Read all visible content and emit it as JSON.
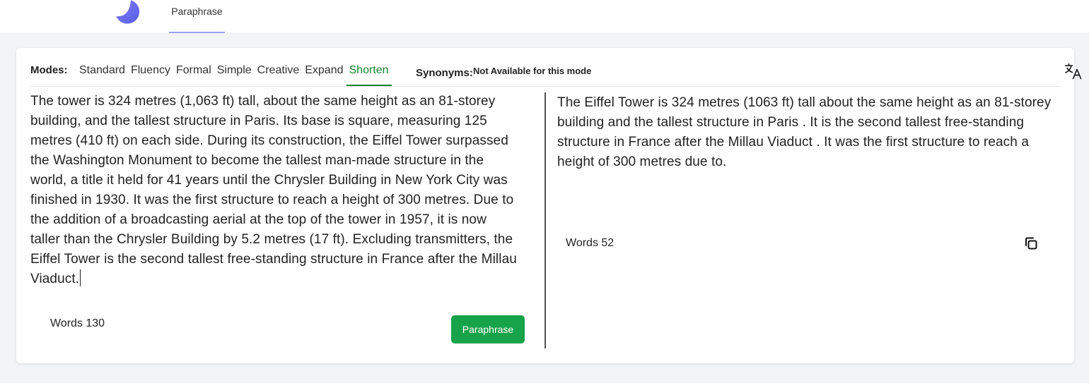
{
  "header": {
    "nav_tab": "Paraphrase",
    "logo_icon": "moon-logo-icon",
    "colors": {
      "logo": "#6366f1",
      "tab_underline": "#9aa0f0"
    }
  },
  "modes": {
    "label": "Modes:",
    "items": [
      "Standard",
      "Fluency",
      "Formal",
      "Simple",
      "Creative",
      "Expand",
      "Shorten"
    ],
    "active": "Shorten",
    "active_color": "#16822d"
  },
  "synonyms": {
    "label": "Synonyms:",
    "value": "Not Available for this mode"
  },
  "toolbar": {
    "translate_icon": "translate-icon"
  },
  "input": {
    "text": "The tower is 324 metres (1,063 ft) tall, about the same height as an 81-storey building, and the tallest structure in Paris. Its base is square, measuring 125 metres (410 ft) on each side. During its construction, the Eiffel Tower surpassed the Washington Monument to become the tallest man-made structure in the world, a title it held for 41 years until the Chrysler Building in New York City was finished in 1930. It was the first structure to reach a height of 300 metres. Due to the addition of a broadcasting aerial at the top of the tower in 1957, it is now taller than the Chrysler Building by 5.2 metres (17 ft). Excluding transmitters, the Eiffel Tower is the second tallest free-standing structure in France after the Millau Viaduct.",
    "words_label": "Words 130",
    "button_label": "Paraphrase",
    "button_color": "#16a34a"
  },
  "output": {
    "text": "The Eiffel Tower is 324 metres (1063 ft) tall about the same height as an 81-storey building and the tallest structure in Paris . It is the second tallest free-standing structure in France after the Millau Viaduct . It was the first structure to reach a height of 300 metres due to.",
    "words_label": "Words 52",
    "copy_icon": "copy-icon"
  }
}
